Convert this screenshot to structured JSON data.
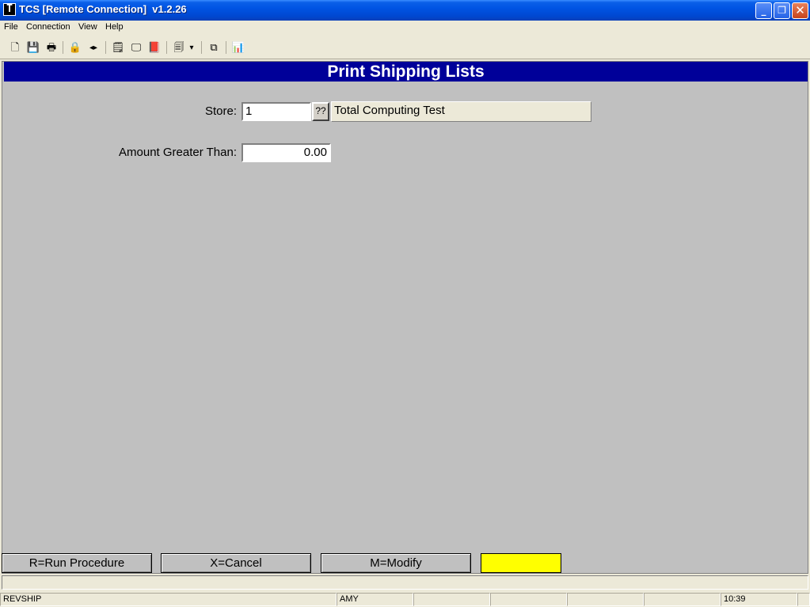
{
  "window": {
    "title": "TCS [Remote Connection]  v1.2.26",
    "app_icon_glyph": "T",
    "minimize_glyph": "_",
    "restore_glyph": "❐",
    "close_glyph": "✕"
  },
  "menu": {
    "items": [
      "File",
      "Connection",
      "View",
      "Help"
    ]
  },
  "toolbar": {
    "buttons": [
      {
        "name": "new-icon",
        "glyph": "🗋"
      },
      {
        "name": "save-icon",
        "glyph": "💾"
      },
      {
        "name": "print-icon",
        "glyph": "🖶"
      },
      {
        "name": "lock-icon",
        "glyph": "🔒"
      },
      {
        "name": "speaker-icon",
        "glyph": "◂▸"
      },
      {
        "name": "properties-icon",
        "glyph": "🗒"
      },
      {
        "name": "monitor-icon",
        "glyph": "🖵"
      },
      {
        "name": "book-icon",
        "glyph": "📕"
      },
      {
        "name": "document-dropdown-icon",
        "glyph": "🗐"
      },
      {
        "name": "dropdown-arrow-icon",
        "glyph": "▾"
      },
      {
        "name": "network-icon",
        "glyph": "⧉"
      },
      {
        "name": "chart-icon",
        "glyph": "📊"
      }
    ]
  },
  "form": {
    "heading": "Print Shipping Lists",
    "store_label": "Store:",
    "store_value": "1",
    "lookup_label": "??",
    "store_name": "Total Computing Test",
    "amount_label": "Amount Greater Than:",
    "amount_value": "0.00"
  },
  "function_keys": {
    "run": "R=Run Procedure",
    "cancel": "X=Cancel",
    "modify": "M=Modify",
    "highlight_color": "#ffff00"
  },
  "status": {
    "program": "REVSHIP",
    "user": "AMY",
    "time": "10:39"
  },
  "colors": {
    "title_bar": "#0054e3",
    "banner": "#000099",
    "client_bg": "#c0c0c0"
  }
}
